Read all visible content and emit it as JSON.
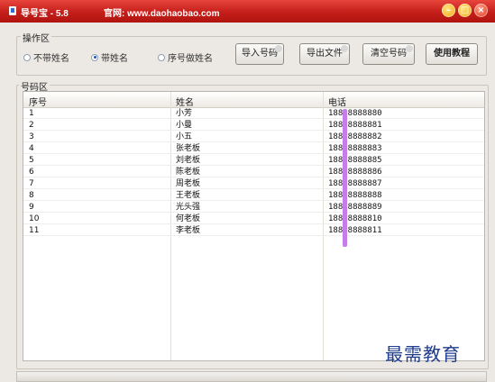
{
  "window": {
    "title": "导号宝 - 5.8",
    "site": "官网: www.daohaobao.com",
    "controls": [
      "minimize-icon",
      "maximize-icon",
      "close-icon"
    ]
  },
  "ops": {
    "group_label": "操作区",
    "radios": [
      {
        "label": "不带姓名",
        "checked": false
      },
      {
        "label": "带姓名",
        "checked": true
      },
      {
        "label": "序号做姓名",
        "checked": false
      }
    ],
    "buttons": [
      "导入号码",
      "导出文件",
      "清空号码",
      "使用教程"
    ]
  },
  "numbers": {
    "group_label": "号码区",
    "columns": [
      "序号",
      "姓名",
      "电话"
    ],
    "rows": [
      [
        "1",
        "小芳",
        "18888888880"
      ],
      [
        "2",
        "小曼",
        "18888888881"
      ],
      [
        "3",
        "小五",
        "18888888882"
      ],
      [
        "4",
        "张老板",
        "18888888883"
      ],
      [
        "5",
        "刘老板",
        "18888888885"
      ],
      [
        "6",
        "陈老板",
        "18888888886"
      ],
      [
        "7",
        "周老板",
        "18888888887"
      ],
      [
        "8",
        "王老板",
        "18888888888"
      ],
      [
        "9",
        "光头强",
        "18888888889"
      ],
      [
        "10",
        "何老板",
        "18888888810"
      ],
      [
        "11",
        "李老板",
        "18888888811"
      ]
    ]
  },
  "watermark": "最需教育",
  "colors": {
    "titlebar": "#c41e1a",
    "highlight": "#c77de8",
    "watermark": "#1f3c8c"
  }
}
